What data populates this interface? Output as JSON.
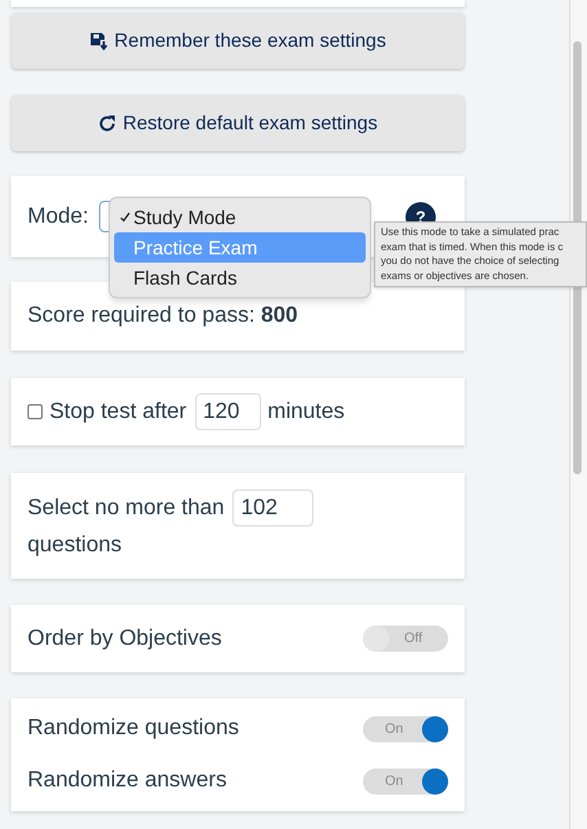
{
  "buttons": [
    {
      "kind": "save",
      "label": "Remember these exam settings"
    },
    {
      "kind": "restore",
      "label": "Restore default exam settings"
    }
  ],
  "mode": {
    "label": "Mode:",
    "help_icon": "?",
    "options": [
      {
        "label": "Study Mode",
        "checked": true,
        "selected": false
      },
      {
        "label": "Practice Exam",
        "checked": false,
        "selected": true
      },
      {
        "label": "Flash Cards",
        "checked": false,
        "selected": false
      }
    ],
    "tooltip": [
      "Use this mode to take a simulated prac",
      "exam that is timed. When this mode is c",
      "you do not have the choice of selecting",
      "exams or objectives are chosen."
    ]
  },
  "score": {
    "label": "Score required to pass:",
    "value": "800"
  },
  "stop_test": {
    "checked": false,
    "label": "Stop test after",
    "value": "120",
    "unit": "minutes"
  },
  "question_limit": {
    "label": "Select no more than",
    "value": "102",
    "unit": "questions"
  },
  "toggle_cards": [
    {
      "items": [
        {
          "label": "Order by Objectives",
          "on": false,
          "state_text": "Off"
        }
      ]
    },
    {
      "items": [
        {
          "label": "Randomize questions",
          "on": true,
          "state_text": "On"
        },
        {
          "label": "Randomize answers",
          "on": true,
          "state_text": "On"
        }
      ]
    }
  ]
}
